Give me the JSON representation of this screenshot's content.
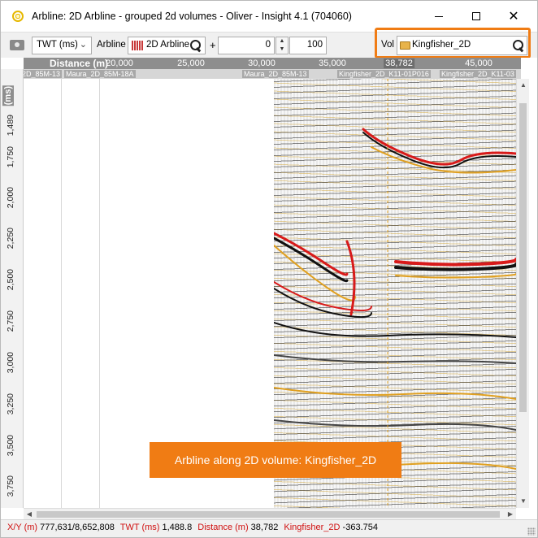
{
  "window": {
    "title": "Arbline: 2D Arbline - grouped 2d volumes - Oliver - Insight 4.1 (704060)",
    "controls": {
      "minimize": "—",
      "maximize": "☐",
      "close": "✕"
    }
  },
  "toolbar": {
    "domain_select": "TWT (ms)",
    "arbline_label": "Arbline",
    "arbline_value": "2D Arbline",
    "plus": "+",
    "offset_value": "0",
    "spin_up": "▲",
    "spin_down": "▼",
    "scale_value": "100",
    "vol_label": "Vol",
    "vol_value": "Kingfisher_2D",
    "highlight_color": "#f07c14"
  },
  "plot": {
    "x_axis_label": "Distance (m)",
    "x_ticks": [
      "20,000",
      "25,000",
      "30,000",
      "35,000",
      "38,782",
      "45,000"
    ],
    "line_names": [
      "2D_85M-13",
      "Maura_2D_85M-18A",
      "Maura_2D_85M-13",
      "Kingfisher_2D_K11-01P016",
      "Kingfisher_2D_K11-03"
    ],
    "y_axis_label": "(ms)",
    "y_ticks": [
      "1,489",
      "1,750",
      "2,000",
      "2,250",
      "2,500",
      "2,750",
      "3,000",
      "3,250",
      "3,500",
      "3,750"
    ]
  },
  "callout": {
    "text": "Arbline along 2D volume: Kingfisher_2D"
  },
  "status": {
    "xy_label": "X/Y (m)",
    "xy_value": "777,631/8,652,808",
    "twt_label": "TWT (ms)",
    "twt_value": "1,488.8",
    "distance_label": "Distance (m)",
    "distance_value": "38,782",
    "volume_label": "Kingfisher_2D",
    "amplitude_value": "-363.754"
  }
}
